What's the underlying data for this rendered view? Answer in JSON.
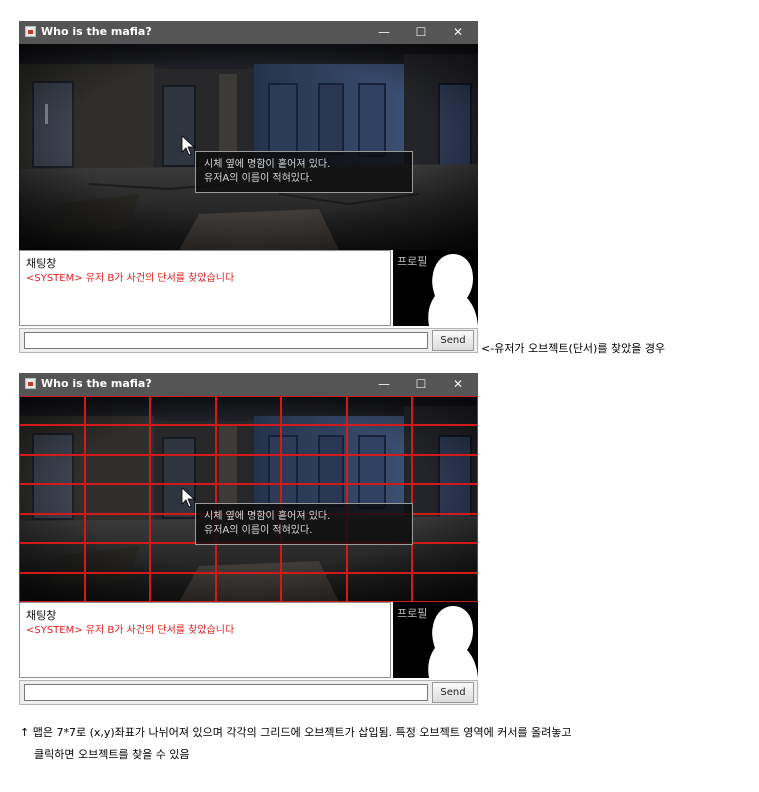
{
  "window": {
    "title": "Who is the mafia?",
    "minimize_glyph": "—",
    "maximize_glyph": "☐",
    "close_glyph": "✕",
    "icon": "java-app-icon"
  },
  "scene": {
    "message_lines": [
      "시체 옆에 명함이 흩어져 있다.",
      "유저A의 이름이 적혀있다."
    ],
    "cursor": "arrow-cursor-icon"
  },
  "grid": {
    "rows": 7,
    "cols": 7,
    "color": "#d21a1a"
  },
  "chat": {
    "title": "채팅창",
    "system_message": "<SYSTEM> 유저 B가 사건의 단서를 찾았습니다",
    "system_color": "#e02020"
  },
  "profile": {
    "label": "프로필"
  },
  "input": {
    "value": "",
    "send_label": "Send"
  },
  "captions": {
    "clue_found": "<-유저가 오브젝트(단서)를 찾았을 경우",
    "grid_note_line1": "↑  맵은 7*7로 (x,y)좌표가 나뉘어져 있으며 각각의 그리드에 오브젝트가 삽입됨. 특정 오브젝트 영역에 커서를 올려놓고",
    "grid_note_line2": "클릭하면 오브젝트를 찾을 수 있음"
  }
}
